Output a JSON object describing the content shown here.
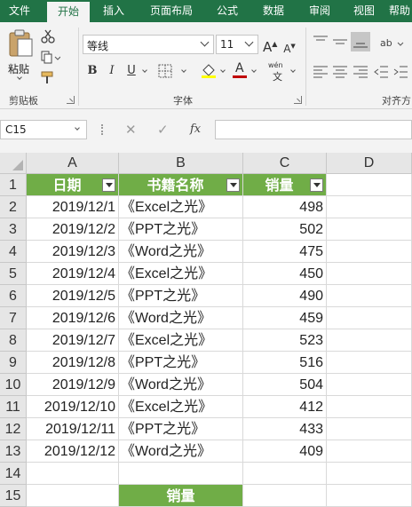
{
  "ribbon_tabs": [
    "文件",
    "开始",
    "插入",
    "页面布局",
    "公式",
    "数据",
    "审阅",
    "视图",
    "帮助"
  ],
  "active_tab": "开始",
  "clipboard": {
    "paste_label": "粘贴",
    "group_label": "剪贴板"
  },
  "font": {
    "name": "等线",
    "size": "11",
    "group_label": "字体",
    "grow_label": "A",
    "shrink_label": "A",
    "bold": "B",
    "italic": "I",
    "underline": "U",
    "font_color_label": "A",
    "phonetic_label": "wén"
  },
  "align": {
    "group_label": "对齐方"
  },
  "formula_bar": {
    "name_box": "C15",
    "fx_label": "fx",
    "cancel": "✕",
    "enter": "✓",
    "content": ""
  },
  "grid": {
    "columns": [
      "A",
      "B",
      "C",
      "D"
    ],
    "rows": [
      "1",
      "2",
      "3",
      "4",
      "5",
      "6",
      "7",
      "8",
      "9",
      "10",
      "11",
      "12",
      "13",
      "14",
      "15"
    ],
    "headers": [
      "日期",
      "书籍名称",
      "销量"
    ],
    "data": [
      [
        "2019/12/1",
        "《Excel之光》",
        "498"
      ],
      [
        "2019/12/2",
        "《PPT之光》",
        "502"
      ],
      [
        "2019/12/3",
        "《Word之光》",
        "475"
      ],
      [
        "2019/12/4",
        "《Excel之光》",
        "450"
      ],
      [
        "2019/12/5",
        "《PPT之光》",
        "490"
      ],
      [
        "2019/12/6",
        "《Word之光》",
        "459"
      ],
      [
        "2019/12/7",
        "《Excel之光》",
        "523"
      ],
      [
        "2019/12/8",
        "《PPT之光》",
        "516"
      ],
      [
        "2019/12/9",
        "《Word之光》",
        "504"
      ],
      [
        "2019/12/10",
        "《Excel之光》",
        "412"
      ],
      [
        "2019/12/11",
        "《PPT之光》",
        "433"
      ],
      [
        "2019/12/12",
        "《Word之光》",
        "409"
      ]
    ],
    "b15": "销量"
  },
  "colors": {
    "ribbon_green": "#217346",
    "header_green": "#70ad47",
    "font_color_bar": "#c00000",
    "fill_color_bar": "#ffff00"
  }
}
